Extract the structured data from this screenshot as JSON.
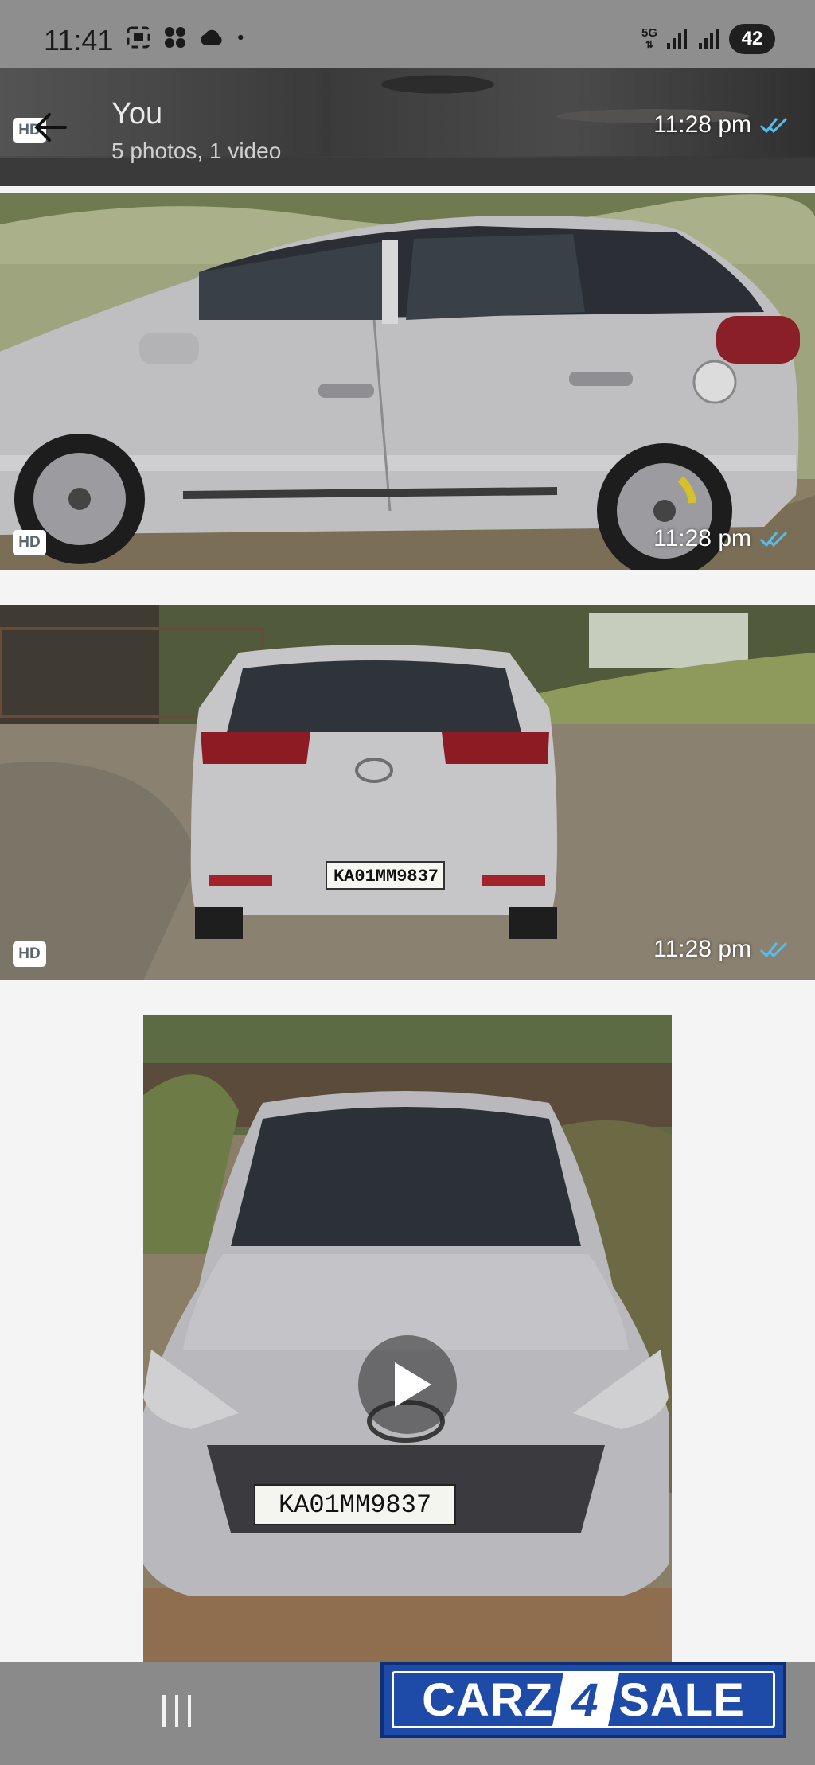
{
  "status_bar": {
    "time": "11:41",
    "network": "5G",
    "battery": "42",
    "icons": [
      "screenshot-icon",
      "fan-icon",
      "cloud-icon",
      "dot-icon",
      "signal-icon",
      "signal-icon"
    ]
  },
  "header": {
    "back_icon": "back-arrow-icon",
    "title": "You",
    "subtitle": "5 photos, 1 video",
    "time": "11:28 pm",
    "hd_badge": "HD"
  },
  "media": [
    {
      "kind": "photo",
      "hd_badge": "HD",
      "time": "11:28 pm",
      "status": "read"
    },
    {
      "kind": "photo",
      "hd_badge": "HD",
      "time": "11:28 pm",
      "status": "read",
      "plate": "KA01MM9837"
    },
    {
      "kind": "video",
      "plate": "KA01MM9837",
      "play_icon": "play-icon"
    }
  ],
  "nav_bar": {
    "menu_icon": "recent-apps-icon"
  },
  "watermark": {
    "part1": "CARZ",
    "part2": "4",
    "part3": "SALE"
  },
  "colors": {
    "read_ticks": "#53bdeb",
    "logo_blue": "#1e4aa8"
  }
}
